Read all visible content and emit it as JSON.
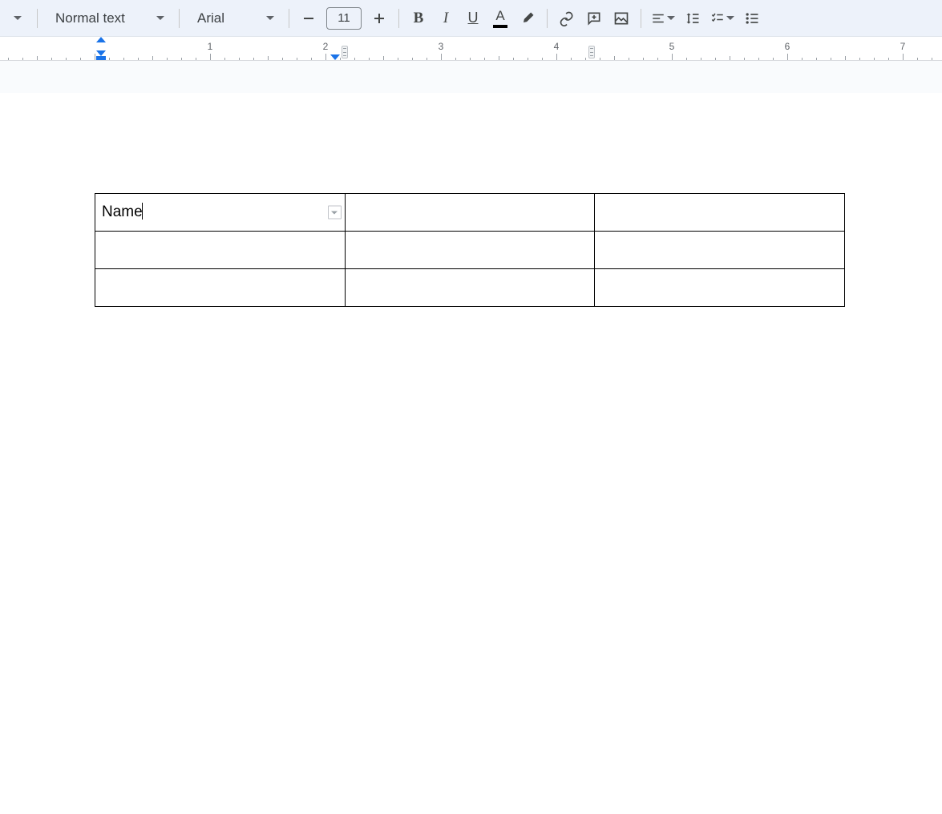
{
  "toolbar": {
    "style": "Normal text",
    "font": "Arial",
    "font_size": "11",
    "bold": "B",
    "italic": "I",
    "underline": "U",
    "text_color": "A"
  },
  "ruler": {
    "numbers": [
      "1",
      "2",
      "3",
      "4",
      "5",
      "6",
      "7"
    ]
  },
  "table": {
    "rows": 3,
    "cols": 3,
    "cells": {
      "r0c0": "Name",
      "r0c1": "",
      "r0c2": "",
      "r1c0": "",
      "r1c1": "",
      "r1c2": "",
      "r2c0": "",
      "r2c1": "",
      "r2c2": ""
    }
  }
}
